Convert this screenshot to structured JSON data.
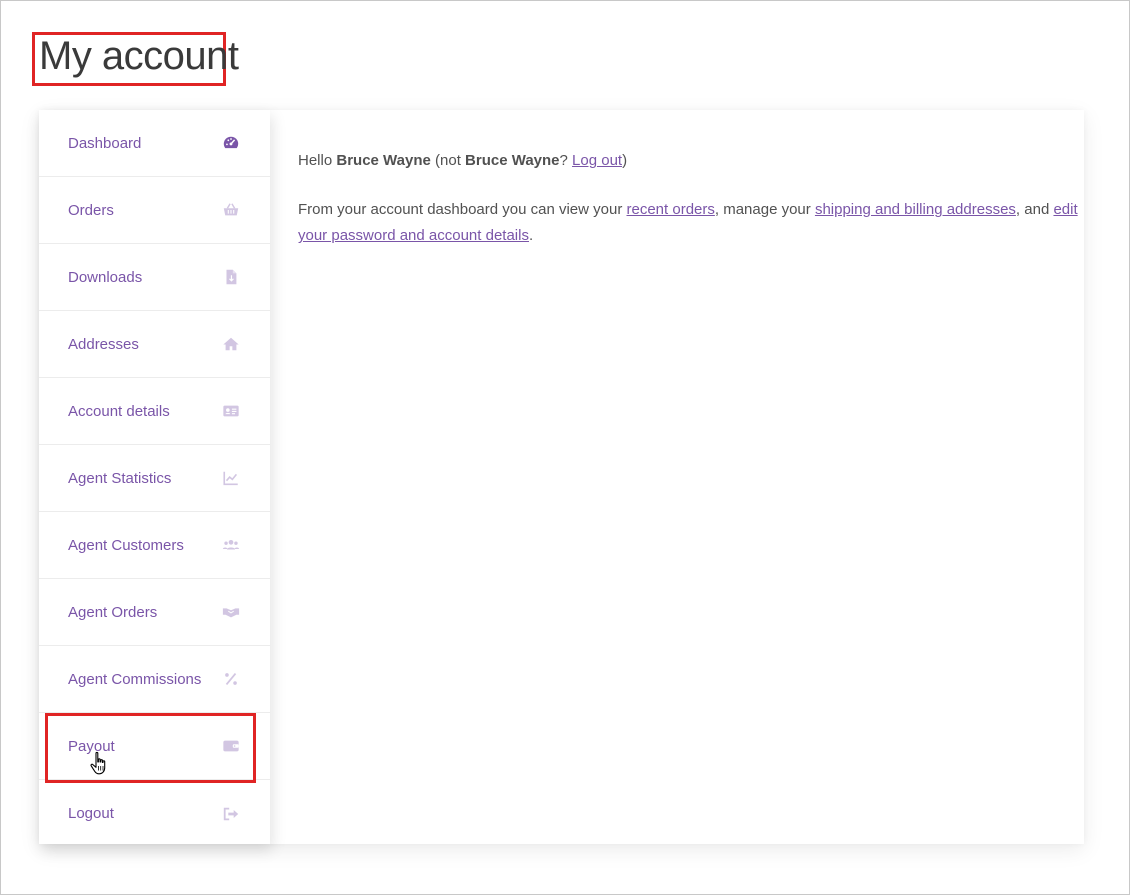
{
  "page": {
    "title": "My account"
  },
  "nav": {
    "items": [
      {
        "label": "Dashboard",
        "icon": "dashboard-gauge-icon",
        "active": true
      },
      {
        "label": "Orders",
        "icon": "basket-icon"
      },
      {
        "label": "Downloads",
        "icon": "file-download-icon"
      },
      {
        "label": "Addresses",
        "icon": "home-icon"
      },
      {
        "label": "Account details",
        "icon": "id-card-icon"
      },
      {
        "label": "Agent Statistics",
        "icon": "chart-line-icon"
      },
      {
        "label": "Agent Customers",
        "icon": "users-icon"
      },
      {
        "label": "Agent Orders",
        "icon": "handshake-icon"
      },
      {
        "label": "Agent Commissions",
        "icon": "percent-icon"
      },
      {
        "label": "Payout",
        "icon": "wallet-icon"
      },
      {
        "label": "Logout",
        "icon": "sign-out-icon"
      }
    ]
  },
  "content": {
    "hello_prefix": "Hello ",
    "user_name": "Bruce Wayne",
    "not_prefix": " (not ",
    "not_name": "Bruce Wayne",
    "question": "? ",
    "logout_link": "Log out",
    "close_paren": ")",
    "dash_text_1": "From your account dashboard you can view your ",
    "recent_orders_link": "recent orders",
    "dash_text_2": ", manage your ",
    "addresses_link": "shipping and billing addresses",
    "dash_text_3": ", and ",
    "account_link": "edit your password and account details",
    "dash_text_4": "."
  },
  "colors": {
    "accent": "#7a55a8",
    "highlight": "#e02424",
    "icon_muted": "#d2c6e2",
    "icon_active": "#7a55a8"
  }
}
